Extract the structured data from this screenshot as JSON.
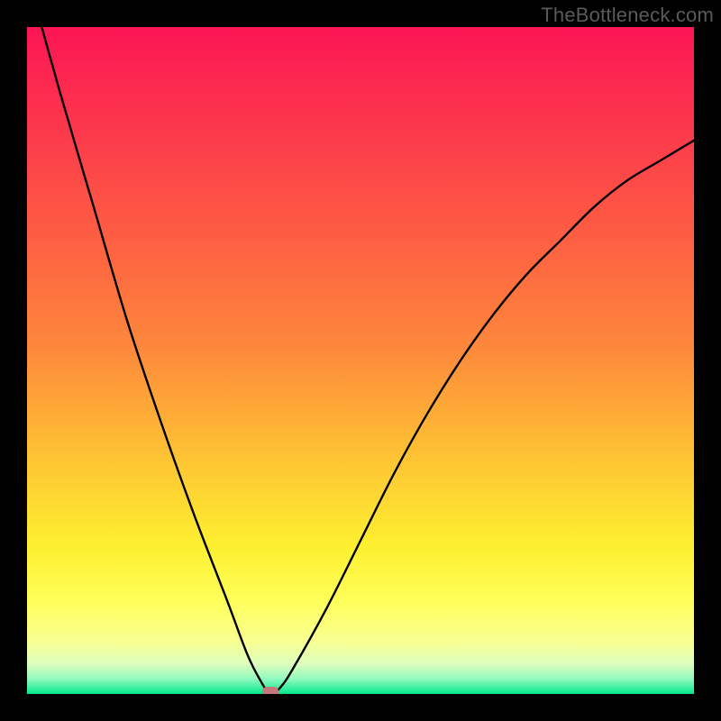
{
  "watermark": "TheBottleneck.com",
  "colors": {
    "bg_top": "#fb1554",
    "bg_mid_upper": "#fd883b",
    "bg_mid": "#fef030",
    "bg_lower_yellow": "#feff59",
    "bg_pale": "#f1ffae",
    "bg_green": "#02e88b",
    "marker": "#c77878",
    "curve": "#000000",
    "frame": "#000000"
  },
  "chart_data": {
    "type": "line",
    "title": "",
    "xlabel": "",
    "ylabel": "",
    "xlim": [
      0,
      100
    ],
    "ylim": [
      0,
      100
    ],
    "series": [
      {
        "name": "bottleneck-curve",
        "x": [
          0,
          5,
          10,
          15,
          20,
          25,
          30,
          33,
          35,
          36.5,
          38,
          40,
          45,
          50,
          55,
          60,
          65,
          70,
          75,
          80,
          85,
          90,
          95,
          100
        ],
        "y": [
          108,
          90,
          73,
          56,
          41,
          27,
          14,
          6,
          2,
          0,
          1,
          4,
          13,
          23,
          33,
          42,
          50,
          57,
          63,
          68,
          73,
          77,
          80,
          83
        ]
      }
    ],
    "marker": {
      "name": "optimal-point",
      "x": 36.5,
      "y": 0,
      "shape": "rounded-rect",
      "color": "#c77878"
    },
    "background_gradient": [
      {
        "pos": 0.0,
        "color": "#fb1554"
      },
      {
        "pos": 0.3,
        "color": "#fd5a43"
      },
      {
        "pos": 0.48,
        "color": "#fd883b"
      },
      {
        "pos": 0.65,
        "color": "#fec533"
      },
      {
        "pos": 0.78,
        "color": "#fef030"
      },
      {
        "pos": 0.86,
        "color": "#feff59"
      },
      {
        "pos": 0.92,
        "color": "#f9ff90"
      },
      {
        "pos": 0.955,
        "color": "#deffbe"
      },
      {
        "pos": 0.978,
        "color": "#8ef9bd"
      },
      {
        "pos": 1.0,
        "color": "#02e88b"
      }
    ]
  }
}
